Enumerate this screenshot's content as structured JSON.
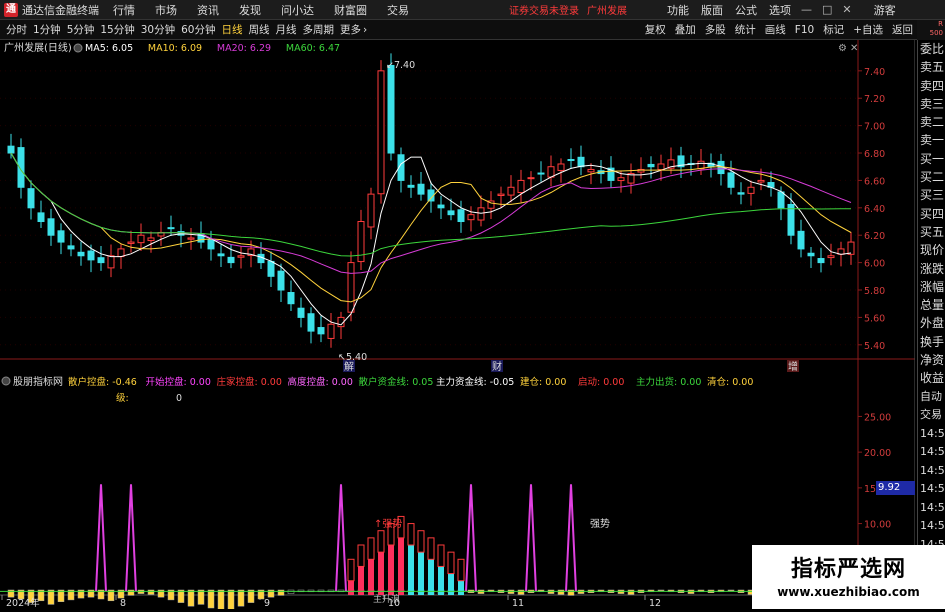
{
  "titlebar": {
    "logo": "通",
    "app_name": "通达信金融终端",
    "menus": [
      "行情",
      "市场",
      "资讯",
      "发现",
      "问小达",
      "财富圈",
      "交易"
    ],
    "warning": "证券交易未登录",
    "stock_name": "广州发展",
    "right_menus": [
      "功能",
      "版面",
      "公式",
      "选项"
    ],
    "window_buttons": [
      "—",
      "□",
      "✕"
    ],
    "user": "游客"
  },
  "toolbar": {
    "periods": [
      "分时",
      "1分钟",
      "5分钟",
      "15分钟",
      "30分钟",
      "60分钟",
      "日线",
      "周线",
      "月线",
      "多周期",
      "更多"
    ],
    "active_period": "日线",
    "right_tools": [
      "复权",
      "叠加",
      "多股",
      "统计",
      "画线",
      "F10",
      "标记",
      "+自选",
      "返回"
    ]
  },
  "corner": {
    "line1": "R",
    "line2": "500"
  },
  "main_chart": {
    "stock_label": "广州发展(日线)",
    "ma": [
      {
        "name": "MA5",
        "value": "6.05",
        "color": "#ffffff"
      },
      {
        "name": "MA10",
        "value": "6.09",
        "color": "#ffd23c"
      },
      {
        "name": "MA20",
        "value": "6.29",
        "color": "#d63cd6"
      },
      {
        "name": "MA60",
        "value": "6.47",
        "color": "#3cd63c"
      }
    ],
    "y_ticks": [
      "7.40",
      "7.20",
      "7.00",
      "6.80",
      "6.60",
      "6.40",
      "6.20",
      "6.00",
      "5.80",
      "5.60",
      "5.40"
    ],
    "high_label": "7.40",
    "low_label": "5.40",
    "markers": [
      "解",
      "财",
      "增"
    ],
    "colors": {
      "up": "#ff3b3b",
      "down": "#3ce0e8"
    }
  },
  "indicator": {
    "name": "股朋指标网",
    "fields": [
      {
        "label": "散户控盘:",
        "value": "-0.46",
        "color": "#ffd23c"
      },
      {
        "label": "开始控盘:",
        "value": "0.00",
        "color": "#ff44ff"
      },
      {
        "label": "庄家控盘:",
        "value": "0.00",
        "color": "#ff3b3b"
      },
      {
        "label": "高度控盘:",
        "value": "0.00",
        "color": "#ff66ff"
      },
      {
        "label": "散户资金线:",
        "value": "0.05",
        "color": "#3cd63c"
      },
      {
        "label": "主力资金线:",
        "value": "-0.05",
        "color": "#ffffff"
      },
      {
        "label": "建仓:",
        "value": "0.00",
        "color": "#ffd23c"
      },
      {
        "label": "启动:",
        "value": "0.00",
        "color": "#ff3b3b"
      },
      {
        "label": "主力出货:",
        "value": "0.00",
        "color": "#3cd63c"
      },
      {
        "label": "清仓:",
        "value": "0.00",
        "color": "#ffd23c"
      }
    ],
    "level_label": "级:",
    "level_value": "0",
    "y_ticks": [
      "25.00",
      "20.00",
      "15.00",
      "10.00",
      "5.00"
    ],
    "current_value": "9.92",
    "annotations": [
      "强势",
      "强势"
    ],
    "bottom_label": "主升浪"
  },
  "x_axis": [
    "2024年",
    "8",
    "9",
    "10",
    "11",
    "12"
  ],
  "right_panel": [
    "委比",
    "卖五",
    "卖四",
    "卖三",
    "卖二",
    "卖一",
    "买一",
    "买二",
    "买三",
    "买四",
    "买五",
    "现价",
    "涨跌",
    "涨幅",
    "总量",
    "外盘",
    "换手",
    "净资",
    "收益"
  ],
  "right_panel_lower": [
    "自动",
    "交易",
    "14:56",
    "14:56",
    "14:56",
    "14:56",
    "14:56",
    "14:56",
    "14:56",
    "14:56",
    "14:56"
  ],
  "watermark": {
    "line1": "指标严选网",
    "line2": "www.xuezhibiao.com"
  }
}
